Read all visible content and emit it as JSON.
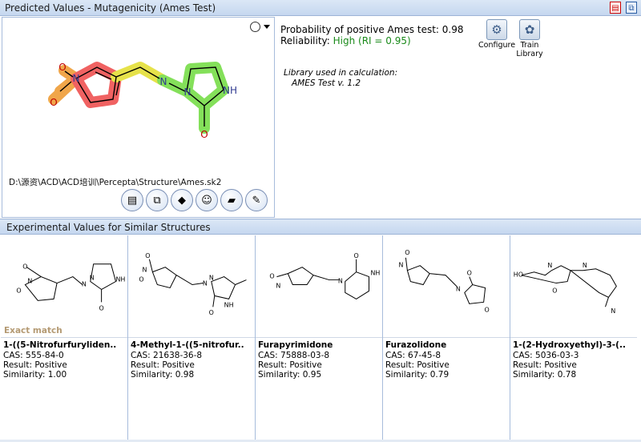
{
  "title_bar": {
    "title": "Predicted Values - Mutagenicity (Ames Test)",
    "icons": [
      "pdf-icon",
      "copy-icon"
    ]
  },
  "structure": {
    "file_path": "D:\\源资\\ACD\\ACD培训\\Percepta\\Structure\\Ames.sk2",
    "atom_labels": [
      "O",
      "N",
      "O",
      "N",
      "N",
      "NH",
      "O"
    ],
    "highlight_colors": {
      "red": "#f06262",
      "orange": "#f0a64a",
      "yellow": "#e6e24a",
      "green": "#84e05a"
    },
    "toolbar_icons": [
      "report-icon",
      "copy-structure-icon",
      "database-icon",
      "smiley-icon",
      "folder-open-icon",
      "edit-pencil-icon"
    ]
  },
  "result": {
    "probability_text": "Probability of positive Ames test: 0.98",
    "reliability_label": "Reliability: ",
    "reliability_value": "High (RI = 0.95)",
    "library_label": "Library used in calculation:",
    "library_value": "AMES Test v. 1.2",
    "configure_label": "Configure",
    "train_label_1": "Train",
    "train_label_2": "Library"
  },
  "similar_section": {
    "title": "Experimental Values for Similar Structures",
    "exact_match": "Exact match",
    "cards": [
      {
        "name": "1-((5-Nitrofurfuryliden..",
        "cas": "CAS: 555-84-0",
        "result": "Result: Positive",
        "similarity": "Similarity: 1.00"
      },
      {
        "name": "4-Methyl-1-((5-nitrofur..",
        "cas": "CAS: 21638-36-8",
        "result": "Result: Positive",
        "similarity": "Similarity: 0.98"
      },
      {
        "name": "Furapyrimidone",
        "cas": "CAS: 75888-03-8",
        "result": "Result: Positive",
        "similarity": "Similarity: 0.95"
      },
      {
        "name": "Furazolidone",
        "cas": "CAS: 67-45-8",
        "result": "Result: Positive",
        "similarity": "Similarity: 0.79"
      },
      {
        "name": "1-(2-Hydroxyethyl)-3-(..",
        "cas": "CAS: 5036-03-3",
        "result": "Result: Positive",
        "similarity": "Similarity: 0.78"
      }
    ]
  }
}
